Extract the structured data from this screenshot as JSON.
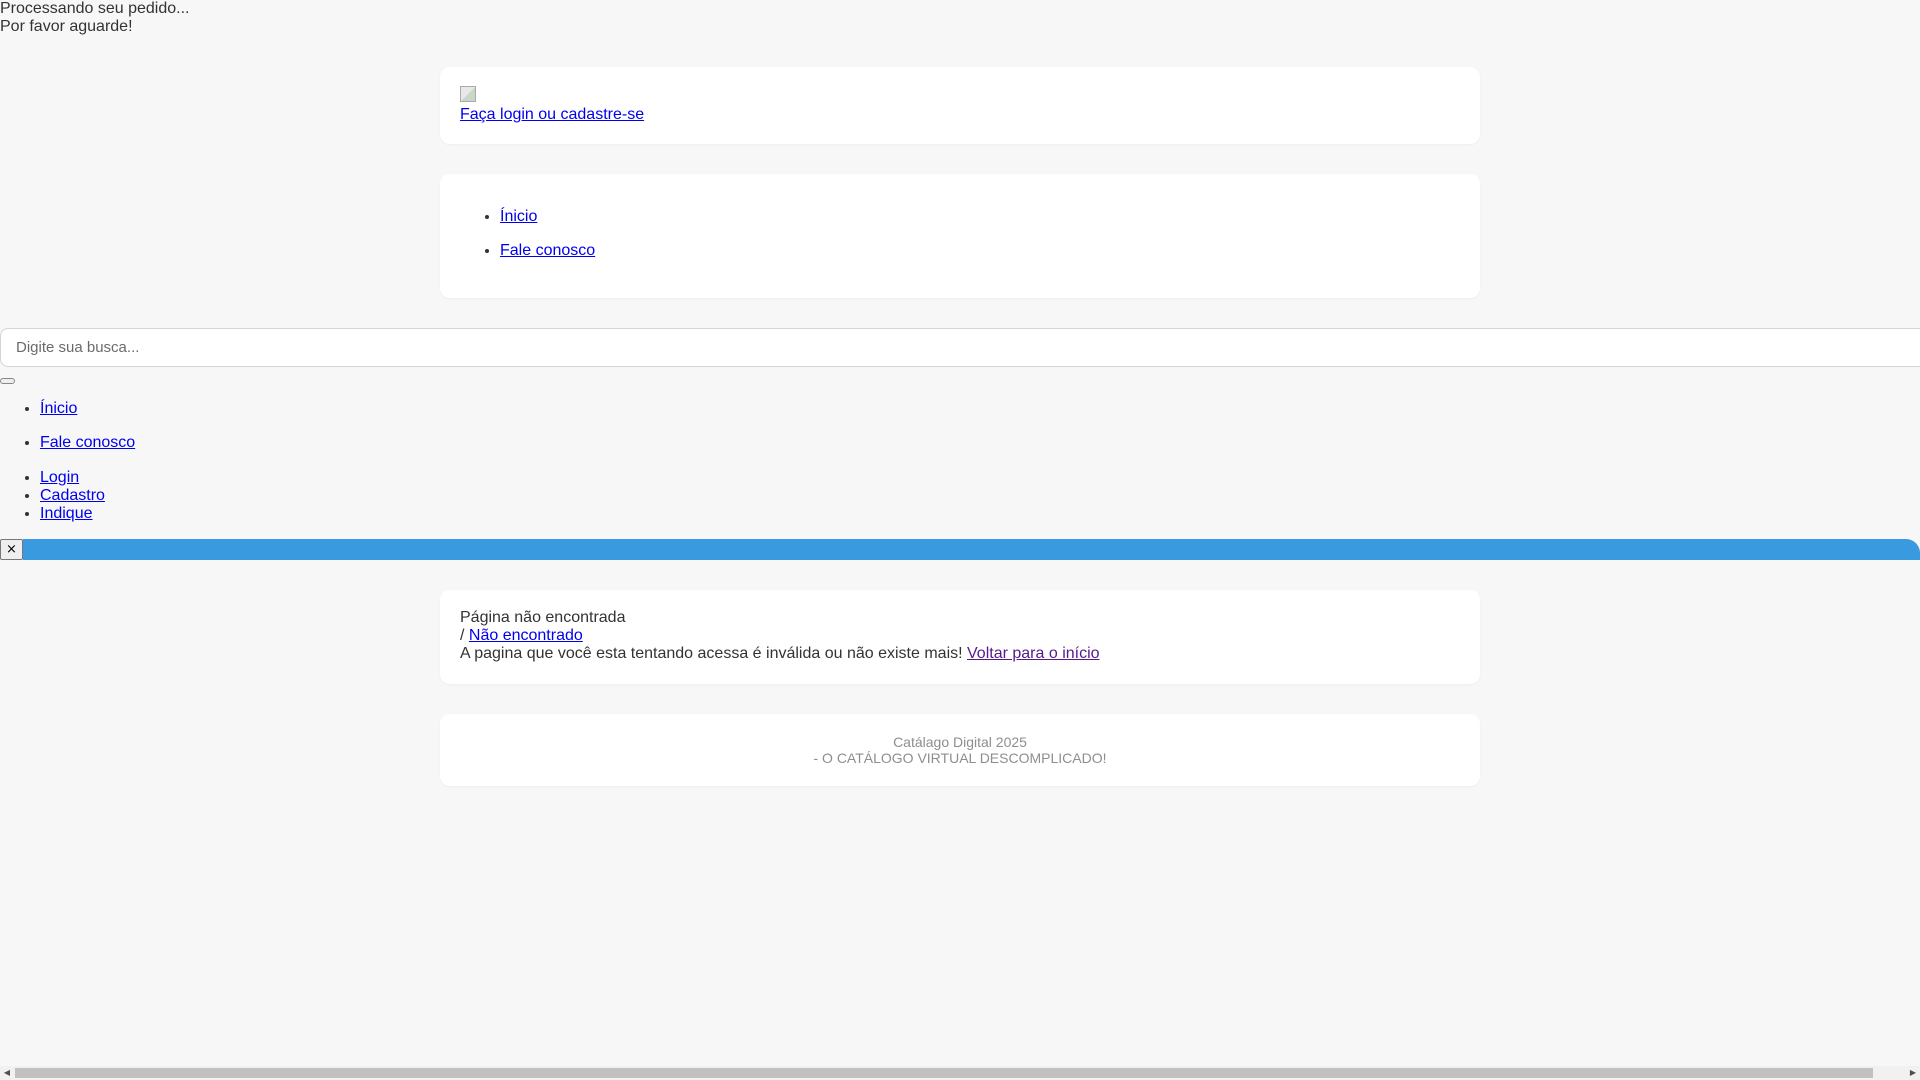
{
  "loading": {
    "line1": "Processando seu pedido...",
    "line2": "Por favor aguarde!"
  },
  "header": {
    "logo_icon": "broken-image-icon",
    "login_link": "Faça login ou cadastre-se"
  },
  "nav": {
    "items": [
      {
        "label": "Ínicio"
      },
      {
        "label": "Fale conosco"
      }
    ]
  },
  "search": {
    "placeholder": "Digite sua busca..."
  },
  "side_menu": {
    "items": [
      {
        "label": "Ínicio"
      },
      {
        "label": "Fale conosco"
      }
    ]
  },
  "account_menu": {
    "items": [
      {
        "label": "Login"
      },
      {
        "label": "Cadastro"
      },
      {
        "label": "Indique"
      }
    ]
  },
  "close_button": {
    "label": "×"
  },
  "error_page": {
    "title": "Página não encontrada",
    "breadcrumb_separator": "/",
    "breadcrumb_current": "Não encontrado",
    "message": "A pagina que você esta tentando acessa é inválida ou não existe mais!",
    "back_link": "Voltar para o início"
  },
  "footer": {
    "line1": "Catálago Digital 2025",
    "line2": "- O CATÁLOGO VIRTUAL DESCOMPLICADO!"
  },
  "colors": {
    "banner": "#3a9adf",
    "background": "#f7f7f8",
    "link": "#0000ee",
    "visited_link": "#551a8b"
  }
}
